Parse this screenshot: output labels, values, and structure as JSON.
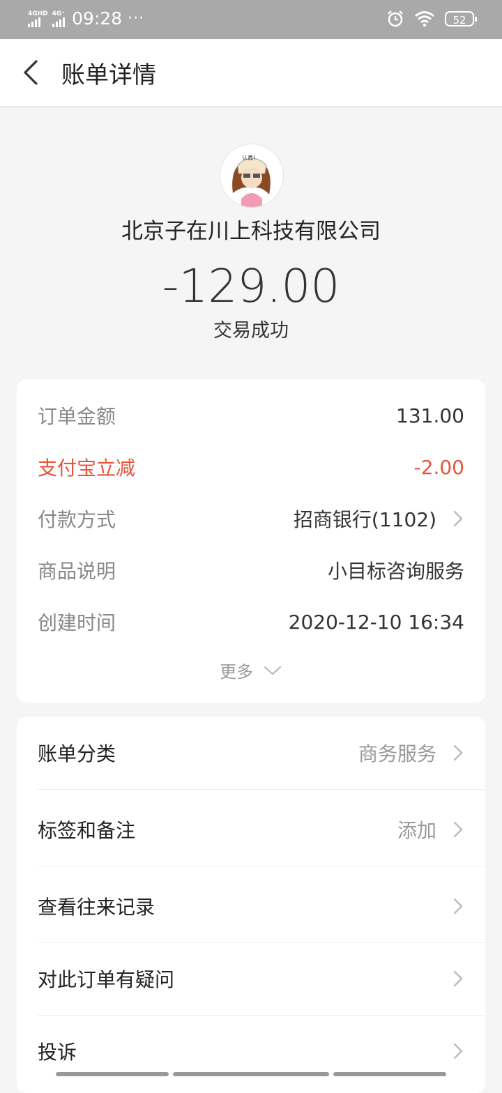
{
  "status_bar": {
    "network1": "4GHD",
    "network2": "4G⁺",
    "time": "09:28",
    "dots": "···",
    "battery": "52"
  },
  "nav": {
    "title": "账单详情"
  },
  "header": {
    "merchant": "北京子在川上科技有限公司",
    "amount": "-129.00",
    "status": "交易成功"
  },
  "details": {
    "rows": [
      {
        "label": "订单金额",
        "value": "131.00"
      },
      {
        "label": "支付宝立减",
        "value": "-2.00"
      },
      {
        "label": "付款方式",
        "value": "招商银行(1102)"
      },
      {
        "label": "商品说明",
        "value": "小目标咨询服务"
      },
      {
        "label": "创建时间",
        "value": "2020-12-10 16:34"
      }
    ],
    "more": "更多"
  },
  "actions": {
    "items": [
      {
        "label": "账单分类",
        "value": "商务服务"
      },
      {
        "label": "标签和备注",
        "value": "添加"
      },
      {
        "label": "查看往来记录",
        "value": ""
      },
      {
        "label": "对此订单有疑问",
        "value": ""
      },
      {
        "label": "投诉",
        "value": ""
      }
    ]
  },
  "colors": {
    "accent_red": "#e8533a",
    "status_bar_bg": "#a9a9a9"
  }
}
